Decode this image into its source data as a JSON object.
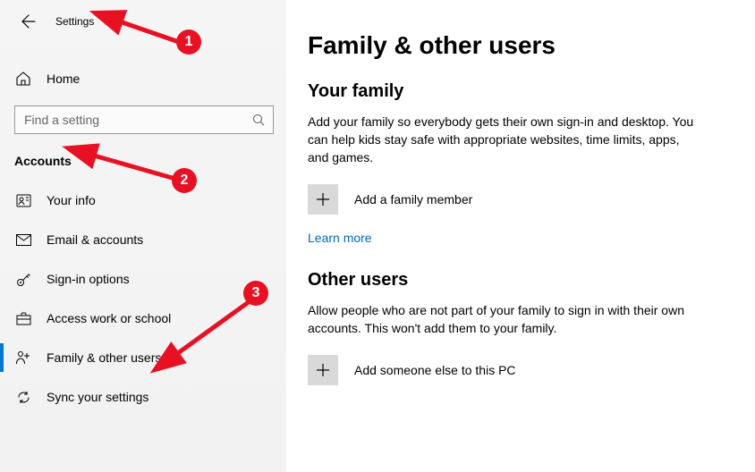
{
  "header": {
    "title": "Settings"
  },
  "home": {
    "label": "Home"
  },
  "search": {
    "placeholder": "Find a setting"
  },
  "category": "Accounts",
  "nav": [
    {
      "icon": "user-icon",
      "label": "Your info"
    },
    {
      "icon": "mail-icon",
      "label": "Email & accounts"
    },
    {
      "icon": "key-icon",
      "label": "Sign-in options"
    },
    {
      "icon": "briefcase-icon",
      "label": "Access work or school"
    },
    {
      "icon": "family-icon",
      "label": "Family & other users",
      "selected": true
    },
    {
      "icon": "sync-icon",
      "label": "Sync your settings"
    }
  ],
  "page": {
    "title": "Family & other users",
    "family": {
      "heading": "Your family",
      "para": "Add your family so everybody gets their own sign-in and desktop. You can help kids stay safe with appropriate websites, time limits, apps, and games.",
      "action": "Add a family member",
      "link": "Learn more"
    },
    "other": {
      "heading": "Other users",
      "para": "Allow people who are not part of your family to sign in with their own accounts. This won't add them to your family.",
      "action": "Add someone else to this PC"
    }
  },
  "annotations": {
    "b1": "1",
    "b2": "2",
    "b3": "3"
  }
}
